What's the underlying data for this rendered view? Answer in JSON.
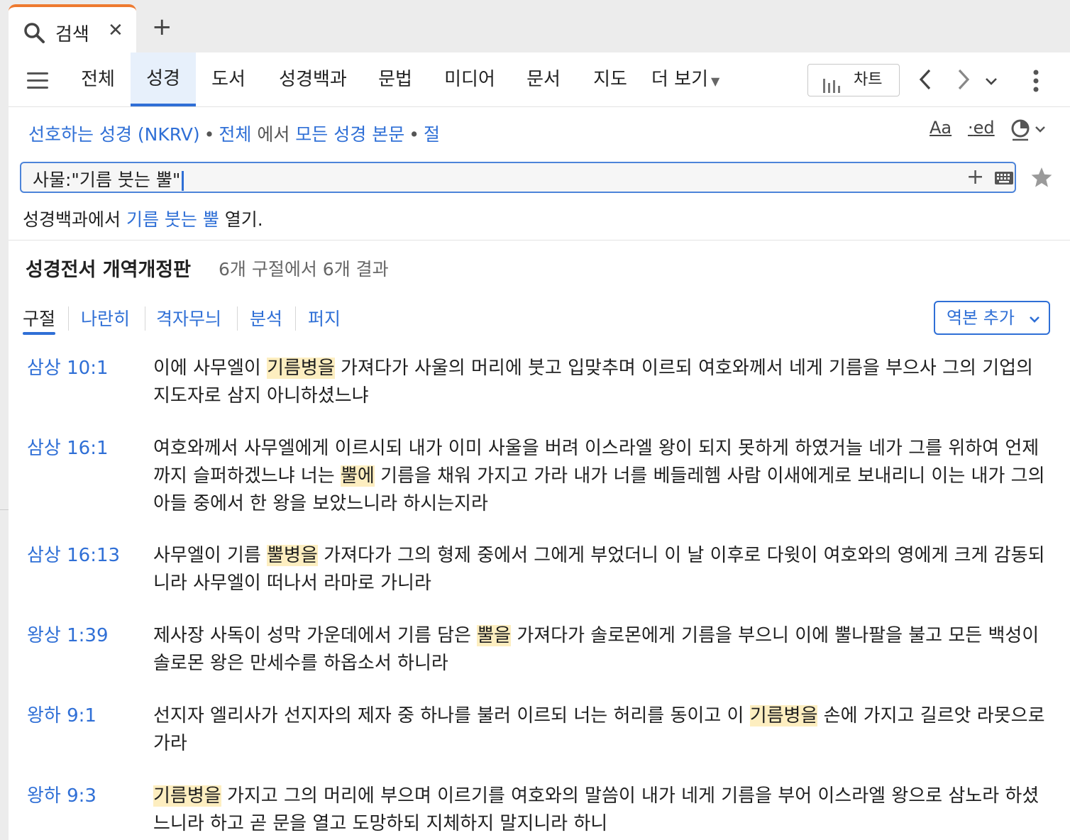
{
  "tab": {
    "label": "검색",
    "close": "✕",
    "new_tab": "+"
  },
  "nav": {
    "tabs": [
      "전체",
      "성경",
      "도서",
      "성경백과",
      "문법",
      "미디어",
      "문서",
      "지도"
    ],
    "more": "더 보기",
    "chart_button": "차트",
    "active_tab": "성경"
  },
  "scope": {
    "bible": "선호하는 성경 (NKRV)",
    "all": "전체",
    "in": "에서",
    "target": "모든 성경 본문",
    "unit": "절"
  },
  "tools": {
    "font": "Aa",
    "ed": "ed"
  },
  "search": {
    "query": "사물:\"기름 붓는 뿔\""
  },
  "open_line": {
    "prefix": "성경백과에서 ",
    "link": "기름 붓는 뿔",
    "suffix": " 열기."
  },
  "results_header": {
    "title": "성경전서 개역개정판",
    "count": "6개 구절에서 6개 결과"
  },
  "view_tabs": [
    "구절",
    "나란히",
    "격자무늬",
    "분석",
    "퍼지"
  ],
  "add_version": "역본 추가",
  "results": [
    {
      "ref": "삼상 10:1",
      "parts": [
        "이에 사무엘이 ",
        "기름병을",
        " 가져다가 사울의 머리에 붓고 입맞추며 이르되 여호와께서 네게 기름을 부으사 그의 기업의 지도자로 삼지 아니하셨느냐"
      ]
    },
    {
      "ref": "삼상 16:1",
      "parts": [
        "여호와께서 사무엘에게 이르시되 내가 이미 사울을 버려 이스라엘 왕이 되지 못하게 하였거늘 네가 그를 위하여 언제까지 슬퍼하겠느냐 너는 ",
        "뿔에",
        " 기름을 채워 가지고 가라 내가 너를 베들레헴 사람 이새에게로 보내리니 이는 내가 그의 아들 중에서 한 왕을 보았느니라 하시는지라"
      ]
    },
    {
      "ref": "삼상 16:13",
      "parts": [
        "사무엘이 기름 ",
        "뿔병을",
        " 가져다가 그의 형제 중에서 그에게 부었더니 이 날 이후로 다윗이 여호와의 영에게 크게 감동되니라 사무엘이 떠나서 라마로 가니라"
      ]
    },
    {
      "ref": "왕상 1:39",
      "parts": [
        "제사장 사독이 성막 가운데에서 기름 담은 ",
        "뿔을",
        " 가져다가 솔로몬에게 기름을 부으니 이에 뿔나팔을 불고 모든 백성이 솔로몬 왕은 만세수를 하옵소서 하니라"
      ]
    },
    {
      "ref": "왕하 9:1",
      "parts": [
        "선지자 엘리사가 선지자의 제자 중 하나를 불러 이르되 너는 허리를 동이고 이 ",
        "기름병을",
        " 손에 가지고 길르앗 라못으로 가라"
      ]
    },
    {
      "ref": "왕하 9:3",
      "parts": [
        "",
        "기름병을",
        " 가지고 그의 머리에 부으며 이르기를 여호와의 말씀이 내가 네게 기름을 부어 이스라엘 왕으로 삼노라 하셨느니라 하고 곧 문을 열고 도망하되 지체하지 말지니라 하니"
      ]
    }
  ],
  "colors": {
    "accent": "#2f6fd6",
    "highlight": "#fdeec0",
    "tab_accent": "#ee7a30"
  }
}
